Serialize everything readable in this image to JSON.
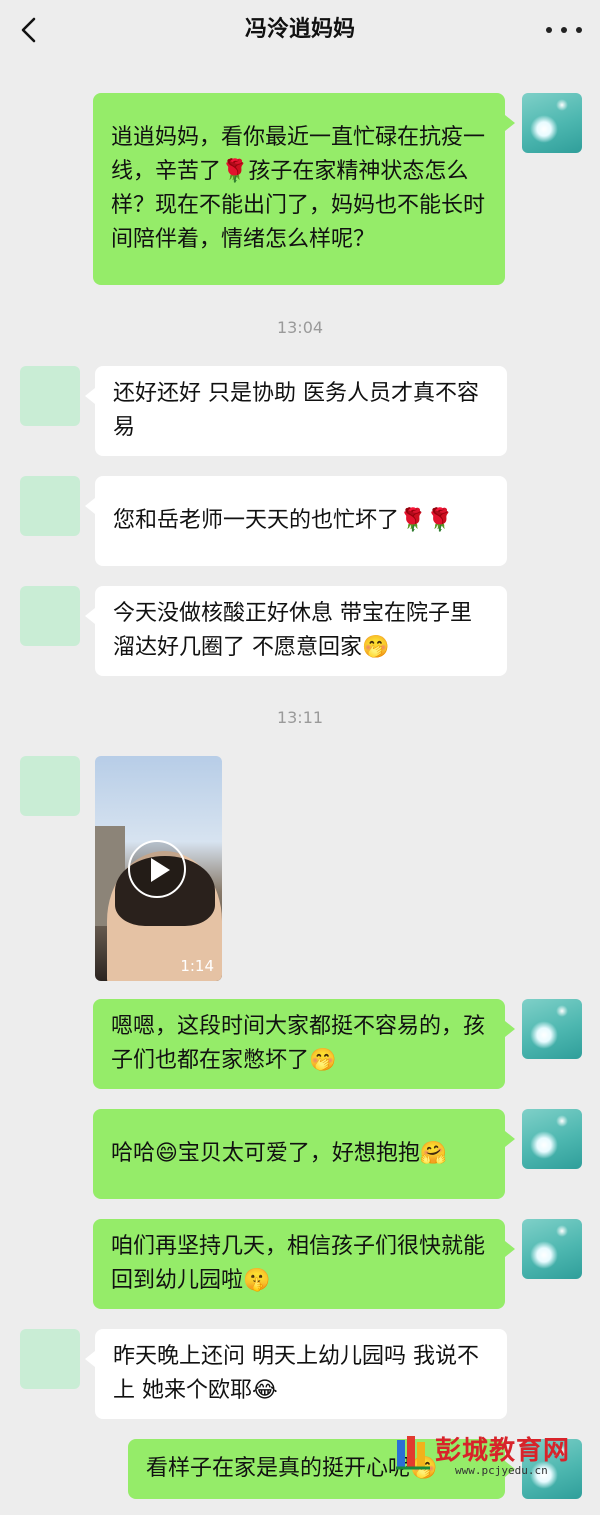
{
  "header": {
    "title": "冯泠逍妈妈",
    "back_icon": "chevron-left-icon",
    "more_icon": "more-dots-icon"
  },
  "timestamps": [
    "13:04",
    "13:11"
  ],
  "messages": [
    {
      "side": "me",
      "text": "逍逍妈妈，看你最近一直忙碌在抗疫一线，辛苦了🌹孩子在家精神状态怎么样？现在不能出门了，妈妈也不能长时间陪伴着，情绪怎么样呢？"
    },
    {
      "side": "other",
      "text": "还好还好 只是协助 医务人员才真不容易"
    },
    {
      "side": "other",
      "text": "您和岳老师一天天的也忙坏了🌹🌹"
    },
    {
      "side": "other",
      "text": "今天没做核酸正好休息 带宝在院子里溜达好几圈了 不愿意回家🤭"
    },
    {
      "side": "other",
      "type": "video",
      "duration": "1:14"
    },
    {
      "side": "me",
      "text": "嗯嗯，这段时间大家都挺不容易的，孩子们也都在家憋坏了🤭"
    },
    {
      "side": "me",
      "text": "哈哈😄宝贝太可爱了，好想抱抱🤗"
    },
    {
      "side": "me",
      "text": "咱们再坚持几天，相信孩子们很快就能回到幼儿园啦🤫"
    },
    {
      "side": "other",
      "text": "昨天晚上还问 明天上幼儿园吗 我说不上 她来个欧耶😂"
    },
    {
      "side": "me",
      "text": "看样子在家是真的挺开心呢🤭"
    }
  ],
  "watermark": {
    "title": "彭城教育网",
    "url": "www.pcjyedu.cn"
  },
  "colors": {
    "background": "#ededed",
    "my_bubble": "#95ec69",
    "other_bubble": "#ffffff"
  }
}
